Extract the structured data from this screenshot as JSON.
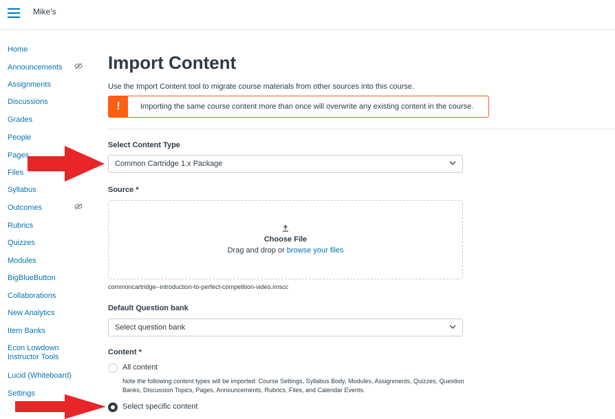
{
  "header": {
    "course_name": "Mike's"
  },
  "sidebar": {
    "items": [
      {
        "label": "Home"
      },
      {
        "label": "Announcements"
      },
      {
        "label": "Assignments"
      },
      {
        "label": "Discussions"
      },
      {
        "label": "Grades"
      },
      {
        "label": "People"
      },
      {
        "label": "Pages"
      },
      {
        "label": "Files"
      },
      {
        "label": "Syllabus"
      },
      {
        "label": "Outcomes"
      },
      {
        "label": "Rubrics"
      },
      {
        "label": "Quizzes"
      },
      {
        "label": "Modules"
      },
      {
        "label": "BigBlueButton"
      },
      {
        "label": "Collaborations"
      },
      {
        "label": "New Analytics"
      },
      {
        "label": "Item Banks"
      },
      {
        "label": "Econ Lowdown Instructor Tools"
      },
      {
        "label": "Lucid (Whiteboard)"
      },
      {
        "label": "Settings"
      }
    ],
    "hidden_icon": "eye-slash-icon"
  },
  "main": {
    "title": "Import Content",
    "intro": "Use the Import Content tool to migrate course materials from other sources into this course.",
    "alert": {
      "icon": "!",
      "text": "Importing the same course content more than once will overwrite any existing content in the course.",
      "color": "#fc5e13"
    },
    "content_type": {
      "label": "Select Content Type",
      "value": "Common Cartridge 1.x Package"
    },
    "source": {
      "label": "Source *",
      "choose_file": "Choose File",
      "drag_text": "Drag and drop or",
      "browse_link": "browse your files",
      "filename": "commoncartridge--introduction-to-perfect-competition-video.imscc"
    },
    "question_bank": {
      "label": "Default Question bank",
      "value": "Select question bank"
    },
    "content": {
      "label": "Content *",
      "options": [
        {
          "label": "All content",
          "selected": false
        },
        {
          "label": "Select specific content",
          "selected": true
        }
      ],
      "note": "Note the following content types will be imported: Course Settings, Syllabus Body, Modules, Assignments, Quizzes, Question Banks, Discussion Topics, Pages, Announcements, Rubrics, Files, and Calendar Events."
    }
  },
  "colors": {
    "link": "#0374b5",
    "text": "#2d3b45",
    "annotation_arrow": "#e8262a"
  }
}
